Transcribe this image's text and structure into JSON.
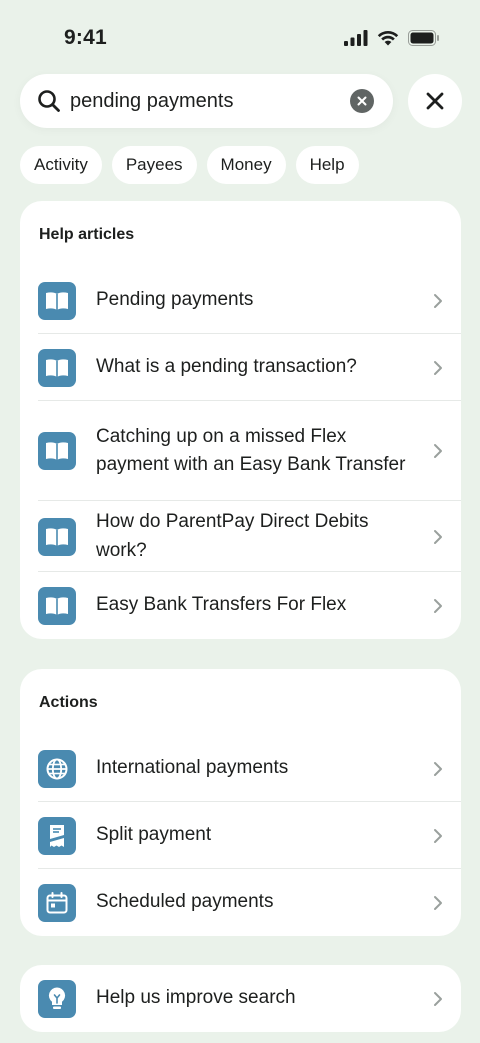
{
  "status": {
    "time": "9:41"
  },
  "search": {
    "value": "pending payments",
    "placeholder": ""
  },
  "chips": [
    "Activity",
    "Payees",
    "Money",
    "Help"
  ],
  "help_articles": {
    "title": "Help articles",
    "items": [
      {
        "label": "Pending payments",
        "icon": "book-icon"
      },
      {
        "label": "What is a pending transaction?",
        "icon": "book-icon"
      },
      {
        "label": "Catching up on a missed Flex payment with an Easy Bank Transfer",
        "icon": "book-icon"
      },
      {
        "label": "How do ParentPay Direct Debits work?",
        "icon": "book-icon"
      },
      {
        "label": "Easy Bank Transfers For Flex",
        "icon": "book-icon"
      }
    ]
  },
  "actions": {
    "title": "Actions",
    "items": [
      {
        "label": "International payments",
        "icon": "globe-icon"
      },
      {
        "label": "Split payment",
        "icon": "split-receipt-icon"
      },
      {
        "label": "Scheduled payments",
        "icon": "calendar-icon"
      }
    ]
  },
  "feedback": {
    "label": "Help us improve search",
    "icon": "lightbulb-icon"
  },
  "colors": {
    "background": "#eaf2ea",
    "icon_tile": "#4a8ab0",
    "card": "#ffffff"
  }
}
